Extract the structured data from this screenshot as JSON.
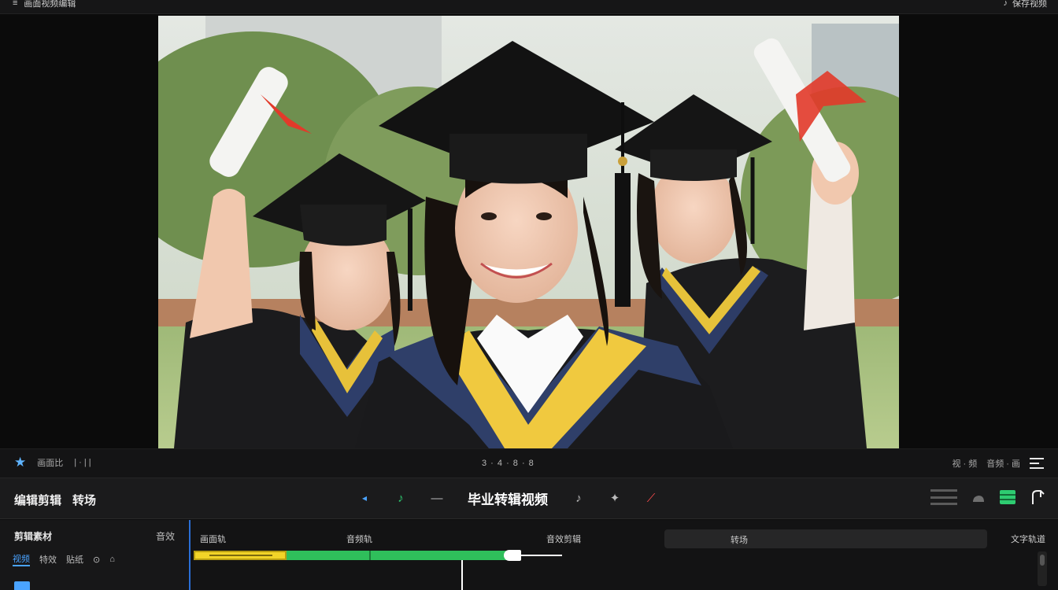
{
  "topbar": {
    "left_glyph": "≡",
    "title": "画面视频编辑",
    "right_glyph": "♪",
    "right_label": "保存视频"
  },
  "player": {
    "left_label": "画面比",
    "left_marks": "| · | |",
    "center_label": "3 · 4 · 8 · 8",
    "right_labels": [
      "视 · 频",
      "音频 · 画"
    ]
  },
  "toolbar": {
    "left_items": [
      "编辑剪辑",
      "转场"
    ],
    "title": "毕业转辑视频",
    "center_buttons": [
      "◂",
      "♪",
      "—",
      "♪",
      "✦",
      "⟋"
    ]
  },
  "timeline": {
    "side_header": "剪辑素材",
    "side_header_right": "音效",
    "side_tabs": [
      "视频",
      "特效",
      "贴纸",
      "⊙",
      "⌂"
    ],
    "labels": [
      "画面轨",
      "音频轨",
      "音效剪辑"
    ],
    "scrubber_label": "转场",
    "right_label": "文字轨道"
  },
  "colors": {
    "accent_blue": "#4aa3ff",
    "clip_yellow": "#f2d428",
    "clip_green": "#2fbf5b",
    "toggle_green": "#2ecc71"
  }
}
